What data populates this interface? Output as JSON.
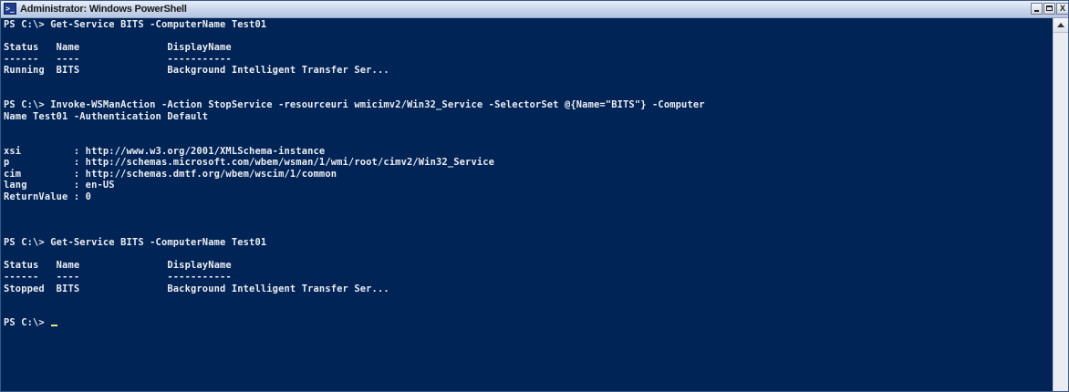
{
  "window": {
    "title": "Administrator: Windows PowerShell",
    "icon_text": ">_",
    "minimize_label": "minimize",
    "maximize_label": "maximize",
    "close_label": "X"
  },
  "console": {
    "lines": [
      "PS C:\\> Get-Service BITS -ComputerName Test01",
      "",
      "Status   Name               DisplayName",
      "------   ----               -----------",
      "Running  BITS               Background Intelligent Transfer Ser...",
      "",
      "",
      "PS C:\\> Invoke-WSManAction -Action StopService -resourceuri wmicimv2/Win32_Service -SelectorSet @{Name=\"BITS\"} -Computer",
      "Name Test01 -Authentication Default",
      "",
      "",
      "xsi         : http://www.w3.org/2001/XMLSchema-instance",
      "p           : http://schemas.microsoft.com/wbem/wsman/1/wmi/root/cimv2/Win32_Service",
      "cim         : http://schemas.dmtf.org/wbem/wscim/1/common",
      "lang        : en-US",
      "ReturnValue : 0",
      "",
      "",
      "",
      "PS C:\\> Get-Service BITS -ComputerName Test01",
      "",
      "Status   Name               DisplayName",
      "------   ----               -----------",
      "Stopped  BITS               Background Intelligent Transfer Ser...",
      "",
      "",
      "PS C:\\> "
    ],
    "colors": {
      "background": "#012456",
      "foreground": "#ecedf1",
      "cursor": "#e6e67a"
    }
  }
}
